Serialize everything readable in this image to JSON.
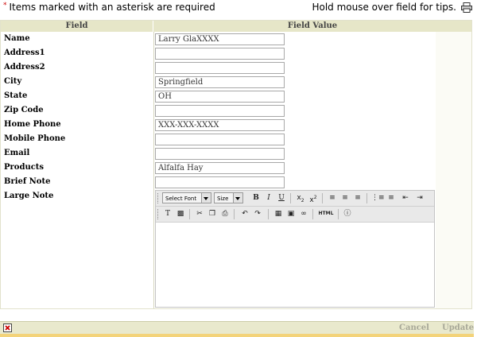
{
  "top": {
    "required_note": "Items marked with an asterisk are required",
    "asterisk": "*",
    "tips": "Hold mouse over field for tips."
  },
  "table": {
    "header_field": "Field",
    "header_value": "Field Value"
  },
  "fields": [
    {
      "label": "Name",
      "value": "Larry GlaXXXX"
    },
    {
      "label": "Address1",
      "value": ""
    },
    {
      "label": "Address2",
      "value": ""
    },
    {
      "label": "City",
      "value": "Springfield"
    },
    {
      "label": "State",
      "value": "OH"
    },
    {
      "label": "Zip Code",
      "value": ""
    },
    {
      "label": "Home Phone",
      "value": "XXX-XXX-XXXX"
    },
    {
      "label": "Mobile Phone",
      "value": ""
    },
    {
      "label": "Email",
      "value": ""
    },
    {
      "label": "Products",
      "value": "Alfalfa Hay"
    },
    {
      "label": "Brief Note",
      "value": ""
    },
    {
      "label": "Large Note",
      "value": ""
    }
  ],
  "editor": {
    "font_select": "Select Font",
    "size_select": "Size",
    "bold": "B",
    "italic": "I",
    "underline": "U",
    "html": "HTML"
  },
  "footer": {
    "cancel": "Cancel",
    "update": "Update"
  },
  "colors": {
    "header_bg": "#e6e6c8",
    "footer_bg": "#e9e9cd",
    "footer_strip": "#f3d37a",
    "asterisk": "#cc0000"
  }
}
